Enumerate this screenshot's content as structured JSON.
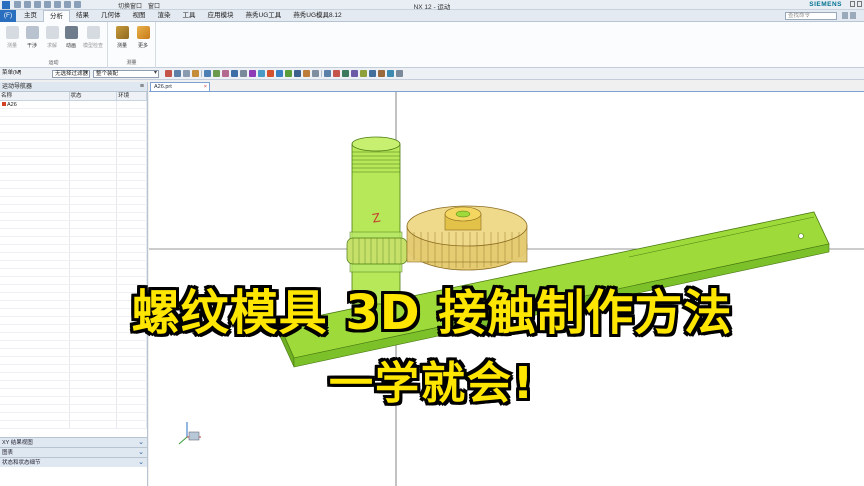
{
  "window": {
    "title": "NX 12 - 运动",
    "brand": "SIEMENS",
    "switch_window_label": "切换窗口",
    "window_menu_label": "窗口"
  },
  "menu": {
    "file_label": "(F)",
    "tabs": [
      "主页",
      "分析",
      "结果",
      "几何体",
      "视图",
      "渲染",
      "工具",
      "应用模块",
      "燕秀UG工具",
      "燕秀UG模具8.12"
    ],
    "active_tab": "分析",
    "search_placeholder": "查找命令"
  },
  "ribbon": {
    "group1": {
      "buttons": [
        "测量",
        "干涉",
        "求解",
        "动画",
        "模型检查"
      ],
      "label": "运动"
    },
    "group2": {
      "buttons": [
        "测量",
        "更多"
      ],
      "label": "测量"
    }
  },
  "selection_bar": {
    "menu_label": "菜单(M)",
    "filter_value": "无选择过滤器",
    "scope_value": "整个装配"
  },
  "navigator": {
    "title": "运动导航器",
    "columns": [
      "名称",
      "状态",
      "环境"
    ],
    "rows": [
      {
        "name": "A26",
        "status": "",
        "env": ""
      }
    ],
    "sections": [
      "XY 结果视图",
      "图表",
      "状态和状态细节"
    ]
  },
  "document": {
    "tab_label": "A26.prt"
  },
  "overlay": {
    "line1": "螺纹模具 3D 接触制作方法",
    "line2": "一学就会!"
  },
  "colors": {
    "part_green": "#9edb3a",
    "gear_tan": "#e5cc72",
    "overlay_text": "#ffe600",
    "accent_blue": "#2a6fbf"
  }
}
